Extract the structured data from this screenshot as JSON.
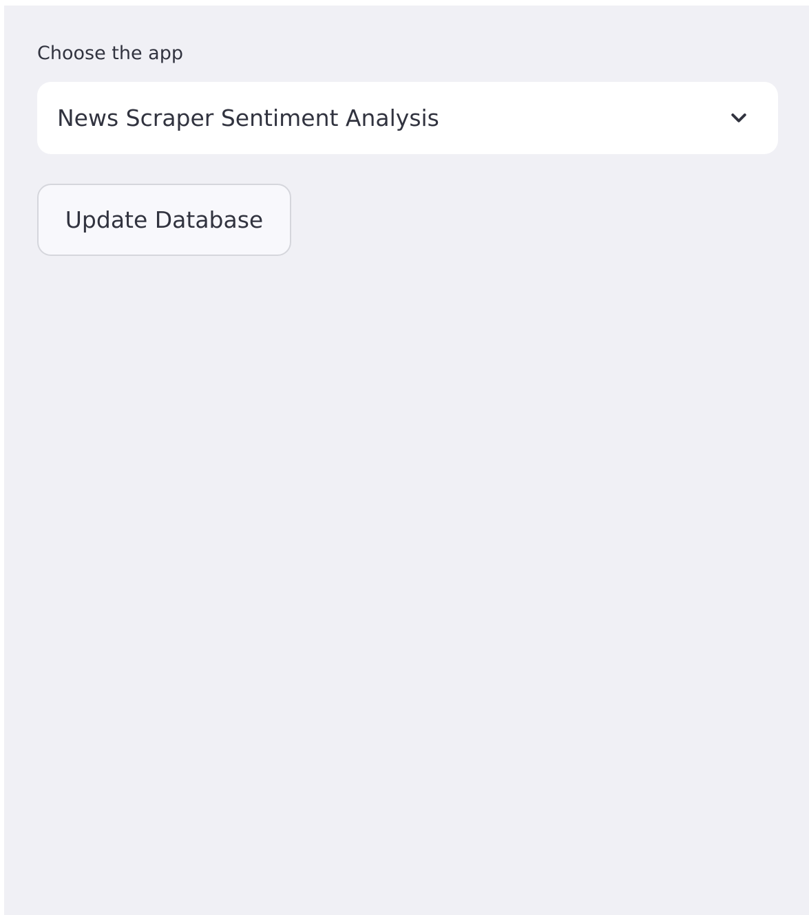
{
  "sidebar": {
    "select": {
      "label": "Choose the app",
      "value": "News Scraper Sentiment Analysis",
      "icon": "chevron-down-icon"
    },
    "update_button": {
      "label": "Update Database"
    }
  },
  "colors": {
    "sidebar_background": "#f0f0f5",
    "text": "#31333f",
    "input_background": "#ffffff",
    "button_border": "#d5d6dc"
  }
}
